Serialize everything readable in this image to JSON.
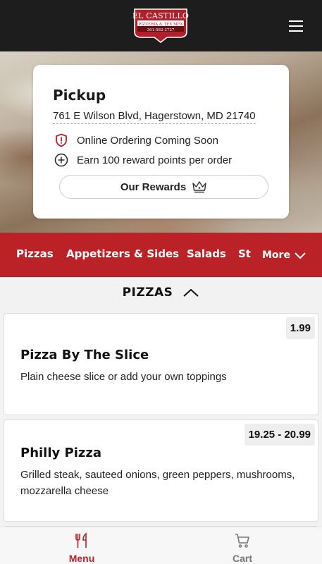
{
  "header": {
    "logo": {
      "line1": "EL CASTILLO",
      "line2": "PIZZERIA & TEX MEX",
      "line3": "301-582-2727"
    },
    "menu_icon": "hamburger-icon"
  },
  "pickup_card": {
    "title": "Pickup",
    "address": "761 E Wilson Blvd, Hagerstown, MD 21740",
    "notice": "Online Ordering Coming Soon",
    "notice_icon": "alert-shield-icon",
    "rewards_text": "Earn 100 reward points per order",
    "rewards_icon": "plus-circle-icon",
    "rewards_button": "Our Rewards",
    "rewards_button_icon": "crown-icon"
  },
  "categories": {
    "items": [
      "Pizzas",
      "Appetizers & Sides",
      "Salads",
      "St"
    ],
    "more_label": "More"
  },
  "section": {
    "title": "PIZZAS"
  },
  "menu_items": [
    {
      "name": "Pizza By The Slice",
      "description": "Plain cheese slice or add your own toppings",
      "price": "1.99"
    },
    {
      "name": "Philly Pizza",
      "description": "Grilled steak, sauteed onions, green peppers, mushrooms, mozzarella cheese",
      "price": "19.25 - 20.99"
    }
  ],
  "bottom_nav": {
    "menu_label": "Menu",
    "cart_label": "Cart"
  },
  "colors": {
    "brand_red": "#ba2227",
    "header_dark": "#1d1d1d"
  }
}
